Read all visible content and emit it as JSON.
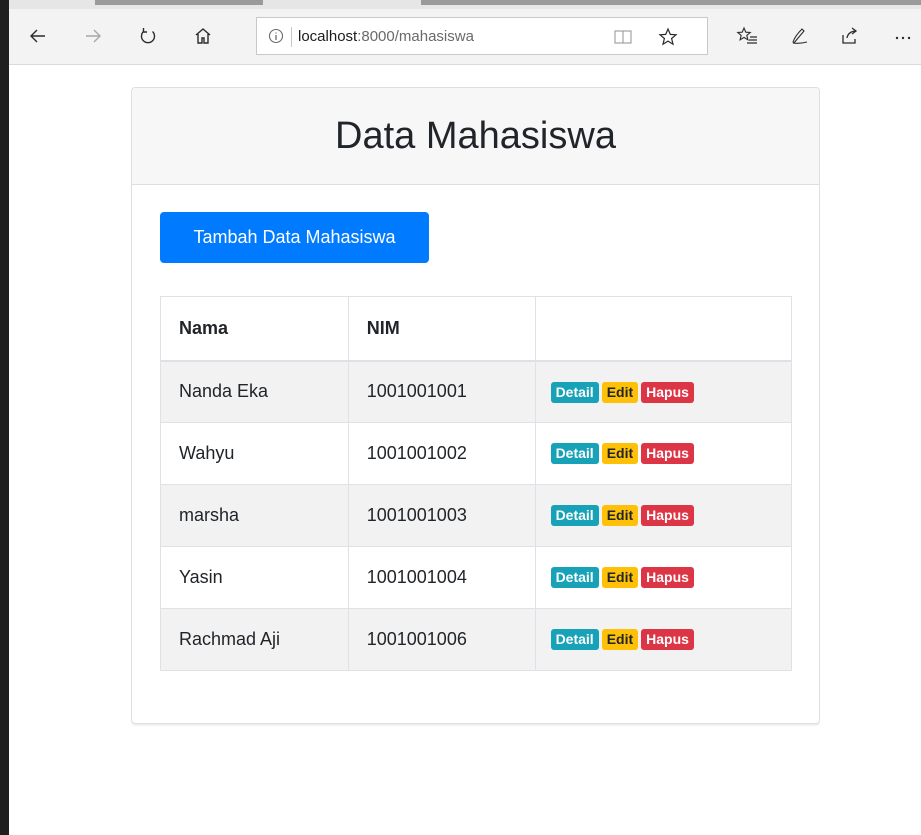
{
  "browser": {
    "url_host": "localhost",
    "url_path": ":8000/mahasiswa",
    "icons": {
      "back": "back-arrow-icon",
      "forward": "forward-arrow-icon",
      "refresh": "refresh-icon",
      "home": "home-icon",
      "info": "info-icon",
      "reader": "reading-view-icon",
      "favorite": "star-icon",
      "favorites": "favorites-list-icon",
      "notes": "pen-icon",
      "share": "share-icon",
      "more": "more-icon"
    }
  },
  "page": {
    "title": "Data Mahasiswa",
    "add_button_label": "Tambah Data Mahasiswa"
  },
  "table": {
    "headers": [
      "Nama",
      "NIM",
      ""
    ],
    "rows": [
      {
        "nama": "Nanda Eka",
        "nim": "1001001001"
      },
      {
        "nama": "Wahyu",
        "nim": "1001001002"
      },
      {
        "nama": "marsha",
        "nim": "1001001003"
      },
      {
        "nama": "Yasin",
        "nim": "1001001004"
      },
      {
        "nama": "Rachmad Aji",
        "nim": "1001001006"
      }
    ],
    "actions": {
      "detail": "Detail",
      "edit": "Edit",
      "hapus": "Hapus"
    }
  },
  "colors": {
    "primary": "#007bff",
    "info": "#17a2b8",
    "warning": "#ffc107",
    "danger": "#dc3545"
  }
}
